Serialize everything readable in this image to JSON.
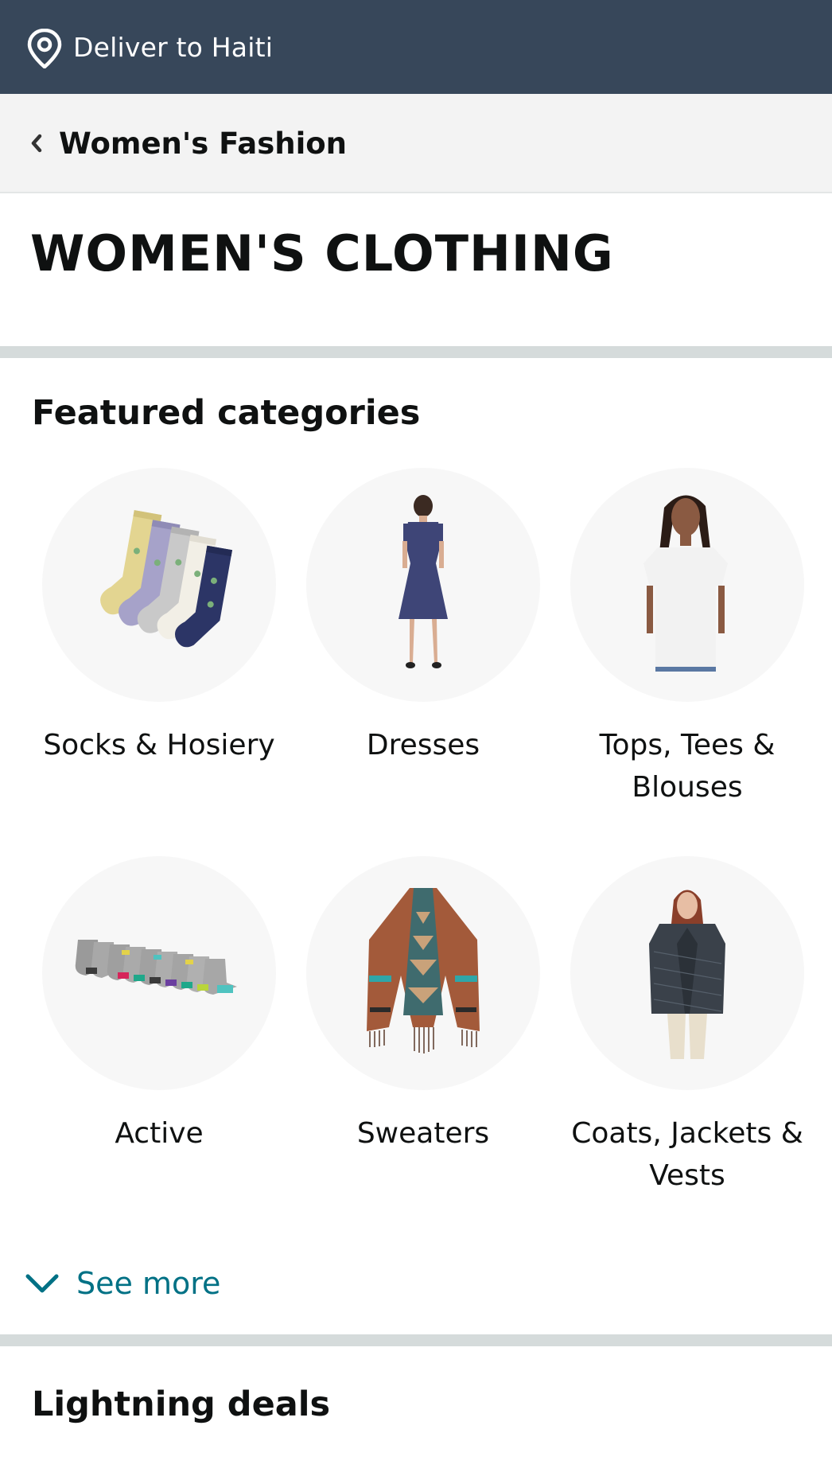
{
  "header": {
    "deliver_text": "Deliver to Haiti",
    "icon": "location-pin-icon"
  },
  "breadcrumb": {
    "back_label": "Women's Fashion",
    "icon": "chevron-left-icon"
  },
  "page": {
    "title": "WOMEN'S CLOTHING"
  },
  "featured": {
    "title": "Featured categories",
    "items": [
      {
        "label": "Socks & Hosiery"
      },
      {
        "label": "Dresses"
      },
      {
        "label": "Tops, Tees & Blouses"
      },
      {
        "label": "Active"
      },
      {
        "label": "Sweaters"
      },
      {
        "label": "Coats, Jackets & Vests"
      }
    ],
    "see_more_label": "See more"
  },
  "deals": {
    "title": "Lightning deals"
  },
  "colors": {
    "topbar": "#37475a",
    "breadcrumb_bg": "#f3f3f3",
    "divider": "#d5dbdb",
    "link": "#007185"
  }
}
